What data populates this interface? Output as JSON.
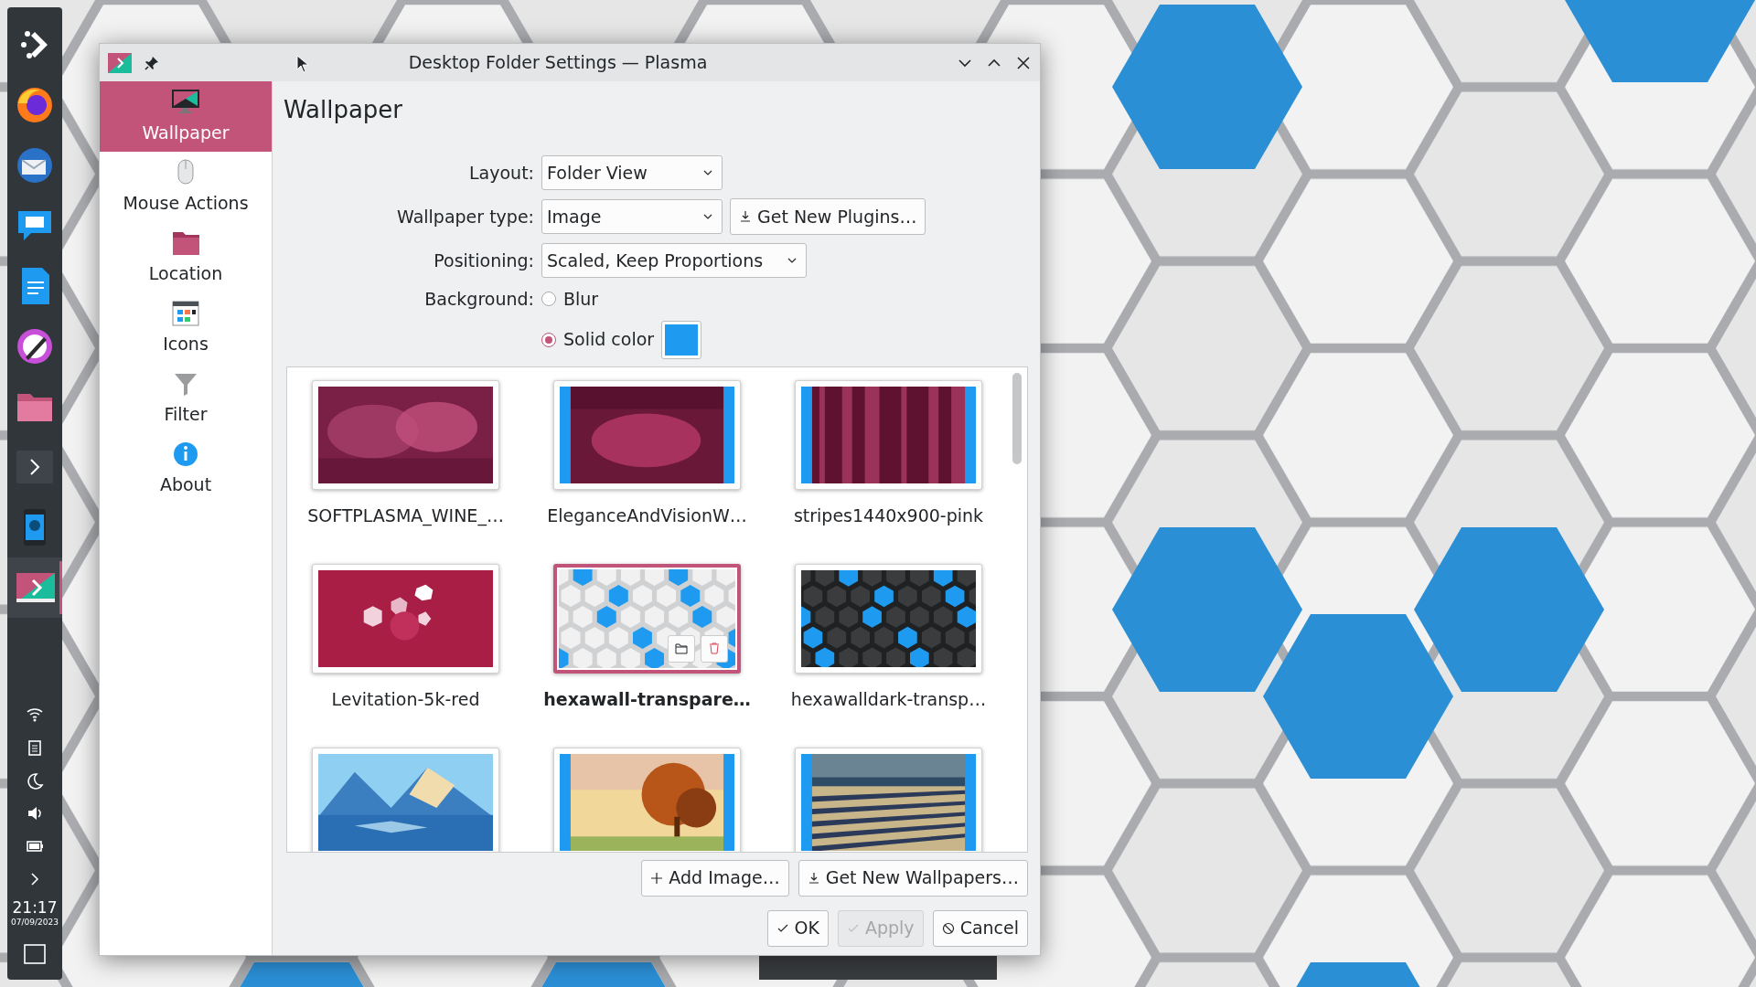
{
  "window": {
    "title": "Desktop Folder Settings — Plasma"
  },
  "taskbar": {
    "apps": [
      {
        "selected": false
      },
      {
        "selected": false
      },
      {
        "selected": false
      },
      {
        "selected": false
      },
      {
        "selected": false
      },
      {
        "selected": false
      },
      {
        "selected": false
      },
      {
        "selected": false
      },
      {
        "selected": true
      }
    ],
    "time": "21:17",
    "date": "07/09/2023"
  },
  "sidebar": {
    "items": [
      {
        "label": "Wallpaper",
        "selected": true
      },
      {
        "label": "Mouse Actions",
        "selected": false
      },
      {
        "label": "Location",
        "selected": false
      },
      {
        "label": "Icons",
        "selected": false
      },
      {
        "label": "Filter",
        "selected": false
      },
      {
        "label": "About",
        "selected": false
      }
    ]
  },
  "page": {
    "heading": "Wallpaper",
    "layout": {
      "label": "Layout:",
      "value": "Folder View"
    },
    "wallpaper_type": {
      "label": "Wallpaper type:",
      "value": "Image",
      "button": "Get New Plugins…"
    },
    "positioning": {
      "label": "Positioning:",
      "value": "Scaled, Keep Proportions"
    },
    "background": {
      "label": "Background:",
      "color": "#1e9bf0",
      "options": [
        {
          "label": "Blur",
          "selected": false
        },
        {
          "label": "Solid color",
          "selected": true
        }
      ]
    }
  },
  "wallpapers": [
    {
      "label": "SOFTPLASMA_WINE_…",
      "selected": false,
      "letterboxed": false
    },
    {
      "label": "EleganceAndVisionW…",
      "selected": false,
      "letterboxed": true
    },
    {
      "label": "stripes1440x900-pink",
      "selected": false,
      "letterboxed": true
    },
    {
      "label": "Levitation-5k-red",
      "selected": false,
      "letterboxed": false
    },
    {
      "label": "hexawall-transpare…",
      "selected": true,
      "letterboxed": false
    },
    {
      "label": "hexawalldark-transp…",
      "selected": false,
      "letterboxed": false
    },
    {
      "selected": false,
      "letterboxed": false
    },
    {
      "selected": false,
      "letterboxed": true
    },
    {
      "selected": false,
      "letterboxed": true
    }
  ],
  "buttons": [
    {
      "label": "Add Image…",
      "kind": "add",
      "disabled": false
    },
    {
      "label": "Get New Wallpapers…",
      "kind": "download",
      "disabled": false
    },
    {
      "label": "OK",
      "kind": "ok",
      "disabled": false
    },
    {
      "label": "Apply",
      "kind": "apply",
      "disabled": true
    },
    {
      "label": "Cancel",
      "kind": "cancel",
      "disabled": false
    }
  ]
}
